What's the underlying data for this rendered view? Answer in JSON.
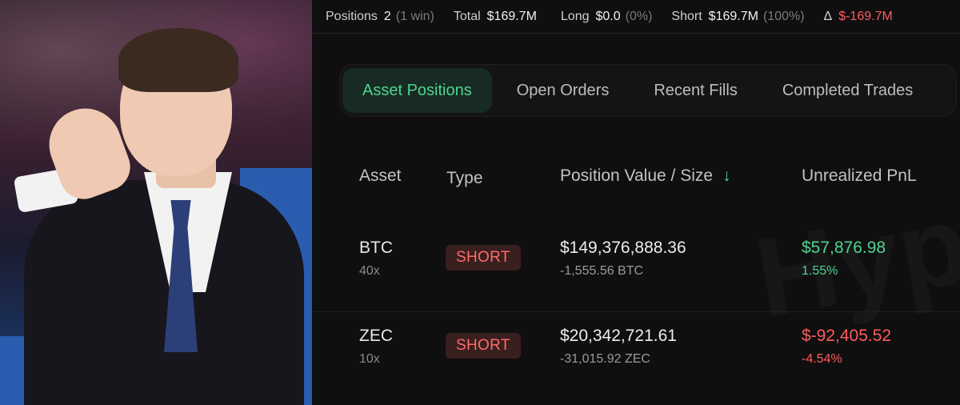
{
  "summary": {
    "positions_label": "Positions",
    "positions_value": "2",
    "positions_sub": "(1 win)",
    "total_label": "Total",
    "total_value": "$169.7M",
    "long_label": "Long",
    "long_value": "$0.0",
    "long_sub": "(0%)",
    "short_label": "Short",
    "short_value": "$169.7M",
    "short_sub": "(100%)",
    "delta_symbol": "Δ",
    "delta_value": "$-169.7M"
  },
  "tabs": [
    {
      "label": "Asset Positions",
      "active": true
    },
    {
      "label": "Open Orders",
      "active": false
    },
    {
      "label": "Recent Fills",
      "active": false
    },
    {
      "label": "Completed Trades",
      "active": false
    }
  ],
  "table": {
    "headers": {
      "asset": "Asset",
      "type": "Type",
      "value": "Position Value / Size",
      "pnl": "Unrealized PnL",
      "sort_icon": "↓"
    },
    "rows": [
      {
        "asset": "BTC",
        "leverage": "40x",
        "type": "SHORT",
        "position_value": "$149,376,888.36",
        "size": "-1,555.56 BTC",
        "pnl": "$57,876.98",
        "pnl_pct": "1.55%",
        "pnl_positive": true
      },
      {
        "asset": "ZEC",
        "leverage": "10x",
        "type": "SHORT",
        "position_value": "$20,342,721.61",
        "size": "-31,015.92 ZEC",
        "pnl": "$-92,405.52",
        "pnl_pct": "-4.54%",
        "pnl_positive": false
      }
    ]
  },
  "watermark": "Hyperdash",
  "colors": {
    "accent_green": "#4ed48f",
    "accent_red": "#ff5c5c",
    "short_badge_bg": "#3a1f1f"
  }
}
